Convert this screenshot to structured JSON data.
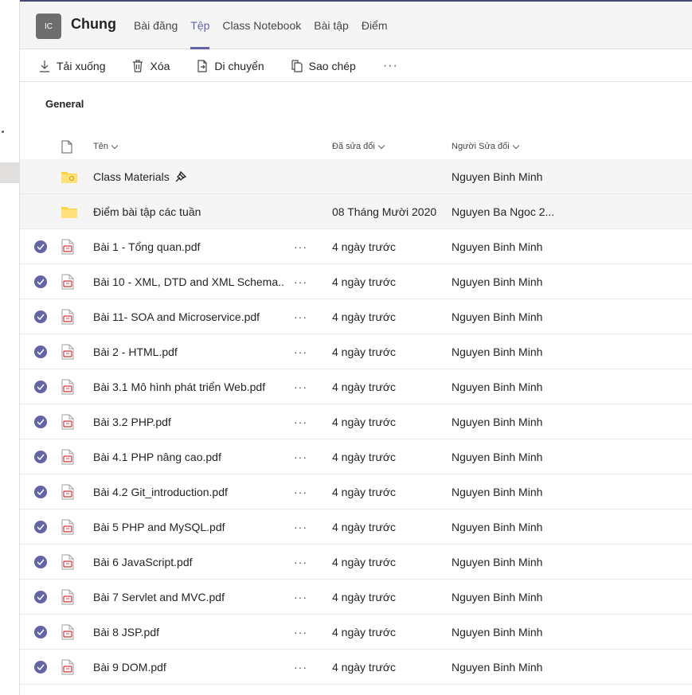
{
  "header": {
    "avatar_text": "IC",
    "channel": "Chung",
    "tabs": [
      {
        "label": "Bài đăng",
        "active": false
      },
      {
        "label": "Tệp",
        "active": true
      },
      {
        "label": "Class Notebook",
        "active": false
      },
      {
        "label": "Bài tập",
        "active": false
      },
      {
        "label": "Điểm",
        "active": false
      }
    ]
  },
  "toolbar": {
    "download": "Tải xuống",
    "delete": "Xóa",
    "move": "Di chuyển",
    "copy": "Sao chép",
    "more": "···"
  },
  "folder_title": "General",
  "columns": {
    "name": "Tên",
    "modified": "Đã sửa đổi",
    "modified_by": "Người Sửa đổi"
  },
  "folders": [
    {
      "name": "Class Materials",
      "modified": "",
      "modified_by": "Nguyen Binh Minh",
      "pinned": true
    },
    {
      "name": "Điểm bài tập các tuần",
      "modified": "08 Tháng Mười 2020",
      "modified_by": "Nguyen Ba Ngoc 2...",
      "pinned": false
    }
  ],
  "files": [
    {
      "name": "Bài 1 - Tổng quan.pdf",
      "more": "···",
      "modified": "4 ngày trước",
      "modified_by": "Nguyen Binh Minh"
    },
    {
      "name": "Bài 10 - XML, DTD and XML Schema....",
      "more": "···",
      "modified": "4 ngày trước",
      "modified_by": "Nguyen Binh Minh"
    },
    {
      "name": "Bài 11- SOA and Microservice.pdf",
      "more": "···",
      "modified": "4 ngày trước",
      "modified_by": "Nguyen Binh Minh"
    },
    {
      "name": "Bài 2 - HTML.pdf",
      "more": "···",
      "modified": "4 ngày trước",
      "modified_by": "Nguyen Binh Minh"
    },
    {
      "name": "Bài 3.1 Mô hình phát triển Web.pdf",
      "more": "···",
      "modified": "4 ngày trước",
      "modified_by": "Nguyen Binh Minh"
    },
    {
      "name": "Bài 3.2 PHP.pdf",
      "more": "···",
      "modified": "4 ngày trước",
      "modified_by": "Nguyen Binh Minh"
    },
    {
      "name": "Bài 4.1 PHP nâng cao.pdf",
      "more": "···",
      "modified": "4 ngày trước",
      "modified_by": "Nguyen Binh Minh"
    },
    {
      "name": "Bài 4.2 Git_introduction.pdf",
      "more": "···",
      "modified": "4 ngày trước",
      "modified_by": "Nguyen Binh Minh"
    },
    {
      "name": "Bài 5 PHP and MySQL.pdf",
      "more": "···",
      "modified": "4 ngày trước",
      "modified_by": "Nguyen Binh Minh"
    },
    {
      "name": "Bài 6 JavaScript.pdf",
      "more": "···",
      "modified": "4 ngày trước",
      "modified_by": "Nguyen Binh Minh"
    },
    {
      "name": "Bài 7 Servlet and MVC.pdf",
      "more": "···",
      "modified": "4 ngày trước",
      "modified_by": "Nguyen Binh Minh"
    },
    {
      "name": "Bài 8 JSP.pdf",
      "more": "···",
      "modified": "4 ngày trước",
      "modified_by": "Nguyen Binh Minh"
    },
    {
      "name": "Bài 9 DOM.pdf",
      "more": "···",
      "modified": "4 ngày trước",
      "modified_by": "Nguyen Binh Minh"
    }
  ],
  "colors": {
    "accent": "#6264a7",
    "folder": "#ffd23f",
    "pdf": "#d13438"
  }
}
